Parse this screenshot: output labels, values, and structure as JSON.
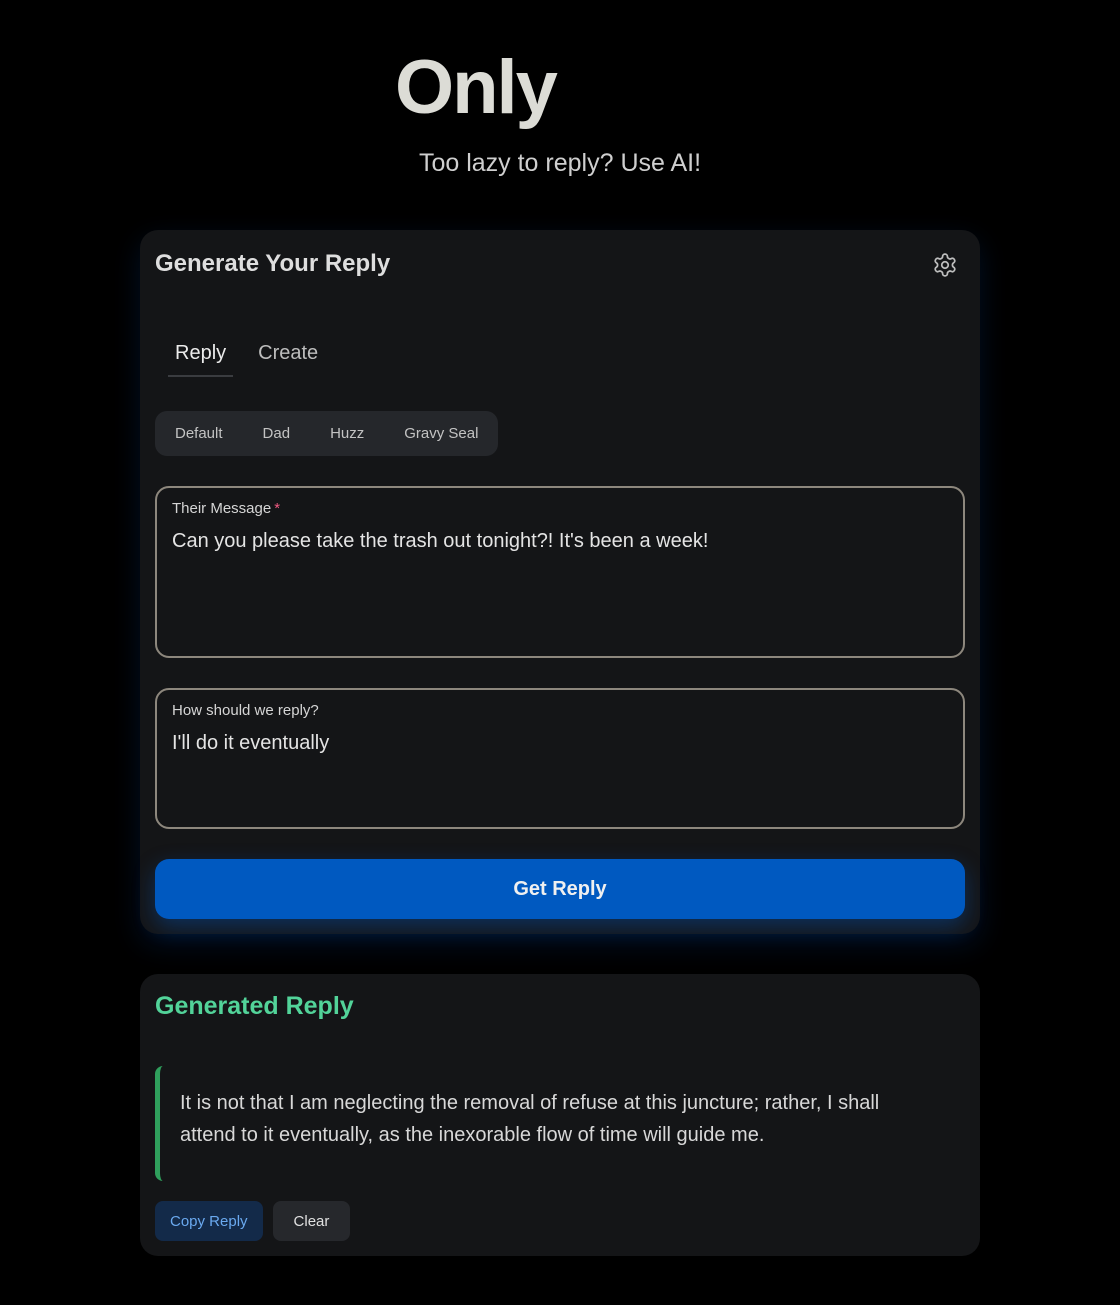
{
  "hero": {
    "title": "Only",
    "subtitle": "Too lazy to reply? Use AI!"
  },
  "generator": {
    "title": "Generate Your Reply",
    "settings_icon": "gear-icon",
    "tabs": [
      {
        "label": "Reply",
        "active": true
      },
      {
        "label": "Create",
        "active": false
      }
    ],
    "personas": [
      "Default",
      "Dad",
      "Huzz",
      "Gravy Seal"
    ],
    "message_field": {
      "label": "Their Message",
      "required_mark": "*",
      "value": "Can you please take the trash out tonight?! It's been a week!"
    },
    "reply_field": {
      "label": "How should we reply?",
      "value": "I'll do it eventually"
    },
    "submit_label": "Get Reply"
  },
  "result": {
    "title": "Generated Reply",
    "text": "It is not that I am neglecting the removal of refuse at this juncture; rather, I shall attend to it eventually, as the inexorable flow of time will guide me.",
    "copy_label": "Copy Reply",
    "clear_label": "Clear"
  },
  "colors": {
    "background": "#000000",
    "card": "#141517",
    "accent_blue": "#0059c0",
    "accent_green": "#52d399",
    "required": "#f25b83"
  }
}
